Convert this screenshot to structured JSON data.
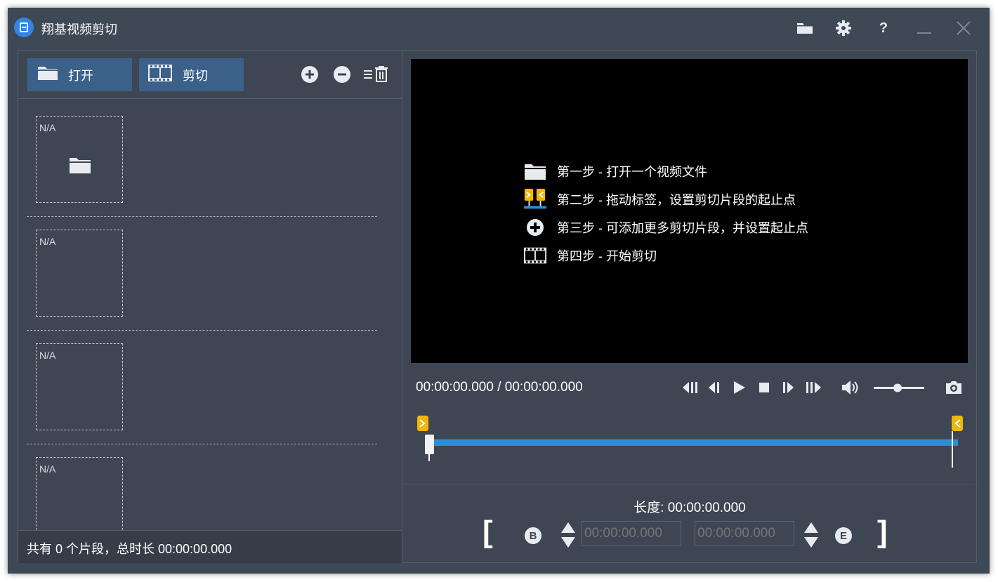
{
  "app": {
    "title": "翔基视频剪切",
    "accent_color": "#2f86e8",
    "titlebar_icons": [
      "folder-icon",
      "gear-icon",
      "help-icon",
      "minimize-icon",
      "close-icon"
    ],
    "help_glyph": "?"
  },
  "left_panel": {
    "toolbar": {
      "open_label": "打开",
      "cut_label": "剪切",
      "icons": [
        "add-clip-icon",
        "remove-clip-icon",
        "clear-list-icon"
      ]
    },
    "clips": [
      {
        "label": "N/A",
        "has_folder_icon": true
      },
      {
        "label": "N/A",
        "has_folder_icon": false
      },
      {
        "label": "N/A",
        "has_folder_icon": false
      },
      {
        "label": "N/A",
        "has_folder_icon": false
      }
    ],
    "footer": "共有 0 个片段，总时长 00:00:00.000"
  },
  "preview": {
    "steps": [
      {
        "icon": "folder-icon",
        "text": "第一步 - 打开一个视频文件"
      },
      {
        "icon": "flag-markers-icon",
        "text": "第二步 - 拖动标签，设置剪切片段的起止点"
      },
      {
        "icon": "add-circle-icon",
        "text": "第三步 - 可添加更多剪切片段，并设置起止点"
      },
      {
        "icon": "film-icon",
        "text": "第四步 - 开始剪切"
      }
    ]
  },
  "playback": {
    "time": "00:00:00.000 / 00:00:00.000",
    "volume_level": 0.5,
    "controls": [
      "skip-to-start-icon",
      "step-back-icon",
      "play-icon",
      "stop-icon",
      "step-forward-icon",
      "skip-to-end-icon",
      "volume-icon",
      "volume-slider",
      "snapshot-icon"
    ]
  },
  "timeline": {
    "start_marker": ">",
    "end_marker": "<",
    "track_color": "#2c8fd6",
    "marker_color": "#f2b705"
  },
  "segment": {
    "length_label": "长度: 00:00:00.000",
    "bracket_left": "[",
    "bracket_right": "]",
    "begin_letter": "B",
    "end_letter": "E",
    "start_time_placeholder": "00:00:00.000",
    "end_time_placeholder": "00:00:00.000"
  }
}
